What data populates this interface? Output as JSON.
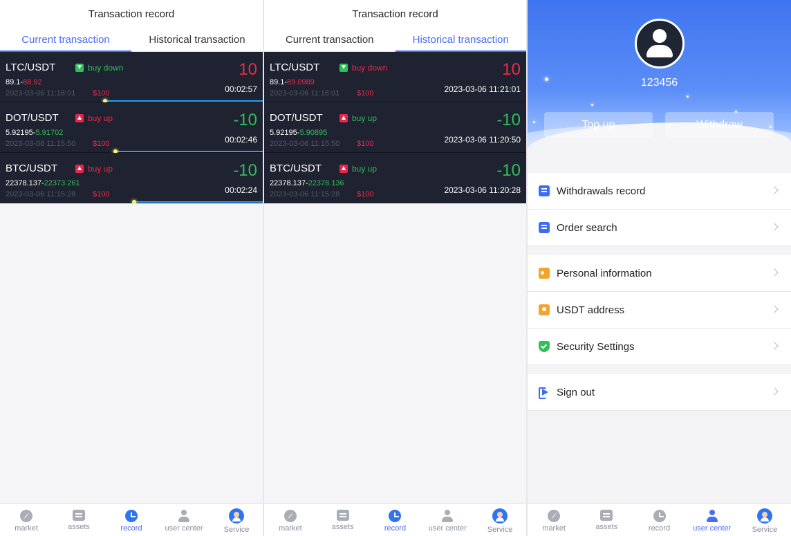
{
  "current": {
    "header": "Transaction record",
    "tabs": [
      "Current transaction",
      "Historical transaction"
    ],
    "rows": [
      {
        "pair": "LTC/USDT",
        "direction": "buy down",
        "open": "89.1",
        "close": "88.92",
        "date": "2023-03-06 11:16:01",
        "amount": "$100",
        "pnl": "10",
        "timer": "00:02:57",
        "progress": 0.6
      },
      {
        "pair": "DOT/USDT",
        "direction": "buy up",
        "open": "5.92195",
        "close": "5.91702",
        "date": "2023-03-06 11:15:50",
        "amount": "$100",
        "pnl": "-10",
        "timer": "00:02:46",
        "progress": 0.56
      },
      {
        "pair": "BTC/USDT",
        "direction": "buy up",
        "open": "22378.137",
        "close": "22373.261",
        "date": "2023-03-06 11:15:28",
        "amount": "$100",
        "pnl": "-10",
        "timer": "00:02:24",
        "progress": 0.49
      }
    ]
  },
  "history": {
    "header": "Transaction record",
    "tabs": [
      "Current transaction",
      "Historical transaction"
    ],
    "rows": [
      {
        "pair": "LTC/USDT",
        "direction": "buy down",
        "open": "89.1",
        "close": "89.0989",
        "date": "2023-03-06 11:16:01",
        "amount": "$100",
        "pnl": "10",
        "closed_at": "2023-03-06 11:21:01"
      },
      {
        "pair": "DOT/USDT",
        "direction": "buy up",
        "open": "5.92195",
        "close": "5.90895",
        "date": "2023-03-06 11:15:50",
        "amount": "$100",
        "pnl": "-10",
        "closed_at": "2023-03-06 11:20:50"
      },
      {
        "pair": "BTC/USDT",
        "direction": "buy up",
        "open": "22378.137",
        "close": "22378.136",
        "date": "2023-03-06 11:15:28",
        "amount": "$100",
        "pnl": "-10",
        "closed_at": "2023-03-06 11:20:28"
      }
    ]
  },
  "profile": {
    "uid": "123456",
    "topup_label": "Top up",
    "withdraw_label": "Withdraw",
    "menu": [
      {
        "label": "Withdrawals record",
        "icon": "document-icon"
      },
      {
        "label": "Order search",
        "icon": "clipboard-icon"
      },
      {
        "label": "Personal information",
        "icon": "id-card-icon"
      },
      {
        "label": "USDT address",
        "icon": "location-pin-icon"
      },
      {
        "label": "Security Settings",
        "icon": "shield-check-icon"
      },
      {
        "label": "Sign out",
        "icon": "sign-out-icon"
      }
    ]
  },
  "tabbar": [
    "market",
    "assets",
    "record",
    "user center",
    "Service"
  ],
  "colors": {
    "accent": "#4a6cf2",
    "up": "#2fbf5b",
    "down": "#f0294a",
    "row_bg": "#1f2230"
  }
}
